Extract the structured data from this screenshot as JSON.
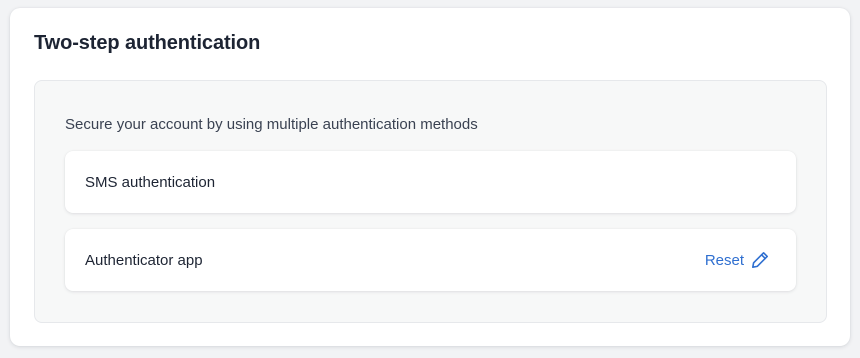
{
  "card": {
    "title": "Two-step authentication"
  },
  "panel": {
    "description": "Secure your account by using multiple authentication methods",
    "methods": [
      {
        "label": "SMS authentication"
      },
      {
        "label": "Authenticator app",
        "action_label": "Reset",
        "action_icon": "pencil-icon"
      }
    ]
  },
  "colors": {
    "accent": "#2f6fd0",
    "text": "#1d2433",
    "panel_bg": "#f7f8f8"
  }
}
